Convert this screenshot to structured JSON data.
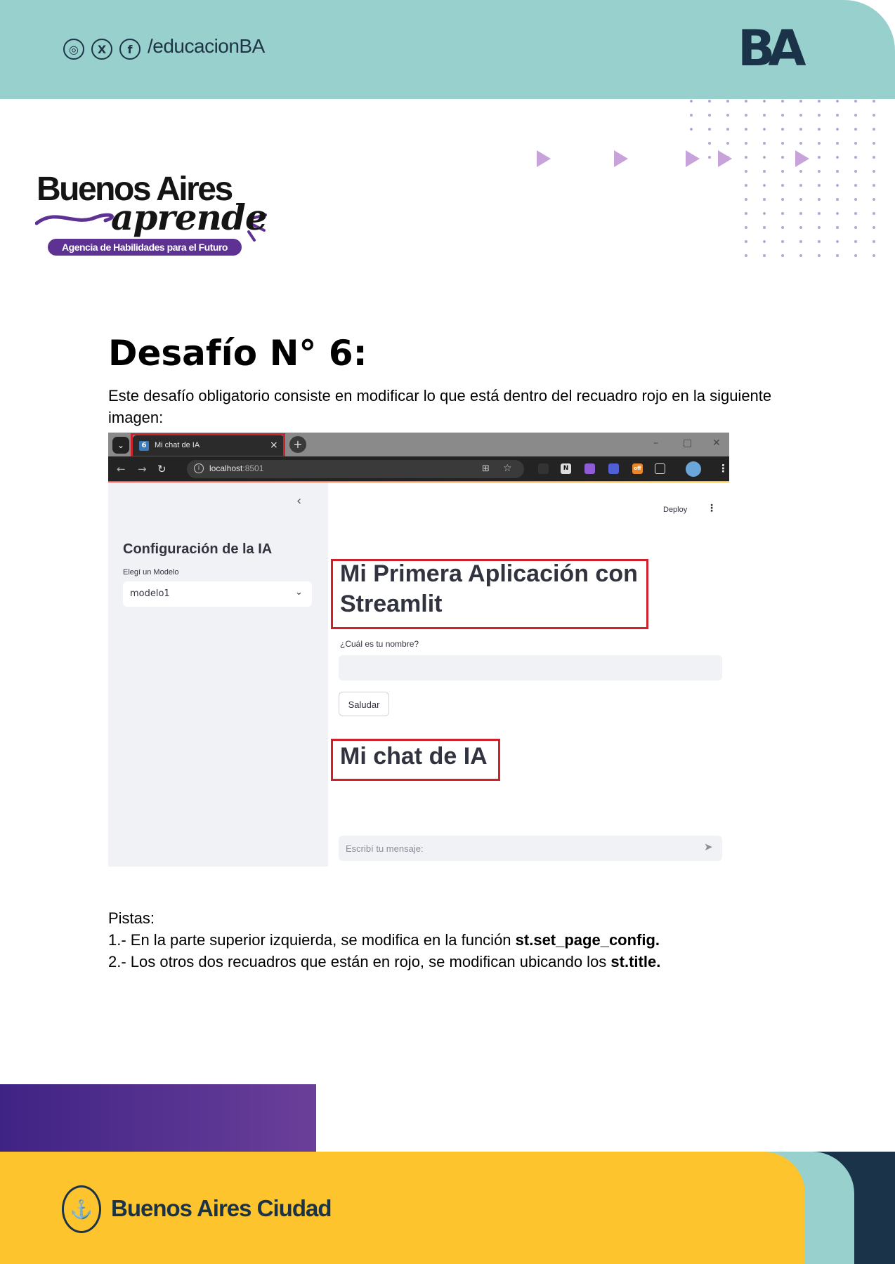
{
  "header": {
    "social_icons": [
      "instagram-icon",
      "x-icon",
      "facebook-icon"
    ],
    "social_glyphs": [
      "◎",
      "X",
      "f"
    ],
    "handle": "/educacionBA",
    "ba_logo": "BA",
    "colors": {
      "teal": "#97d0cc",
      "navy": "#1a3348"
    }
  },
  "logo": {
    "title": "Buenos Aires",
    "script": "aprende",
    "tagline": "Agencia de Habilidades para el Futuro",
    "colors": {
      "purple": "#5e3293"
    }
  },
  "content": {
    "title": "Desafío N° 6:",
    "description": "Este desafío obligatorio consiste en modificar lo que está dentro del recuadro rojo en la siguiente imagen:"
  },
  "screenshot": {
    "tab_favicon": "6",
    "tab_title": "Mi chat de IA",
    "url_host": "localhost",
    "url_port": ":8501",
    "sidebar_title": "Configuración de la IA",
    "model_label": "Elegí un Modelo",
    "model_value": "modelo1",
    "deploy_label": "Deploy",
    "main_title": "Mi Primera Aplicación con Streamlit",
    "name_label": "¿Cuál es tu nombre?",
    "greet_button": "Saludar",
    "chat_title": "Mi chat de IA",
    "chat_placeholder": "Escribí tu mensaje:",
    "highlight_color": "#d0202a",
    "ext_badge": "off"
  },
  "hints": {
    "heading": "Pistas:",
    "hint1_text": "1.- En la parte superior izquierda, se modifica en la función ",
    "hint1_code": "st.set_page_config.",
    "hint2_text": "2.- Los otros dos recuadros que están en rojo, se modifican ubicando los ",
    "hint2_code": "st.title."
  },
  "footer": {
    "city_name": "Buenos Aires Ciudad",
    "colors": {
      "yellow": "#fdc42e",
      "purple": "#5e3293"
    }
  }
}
